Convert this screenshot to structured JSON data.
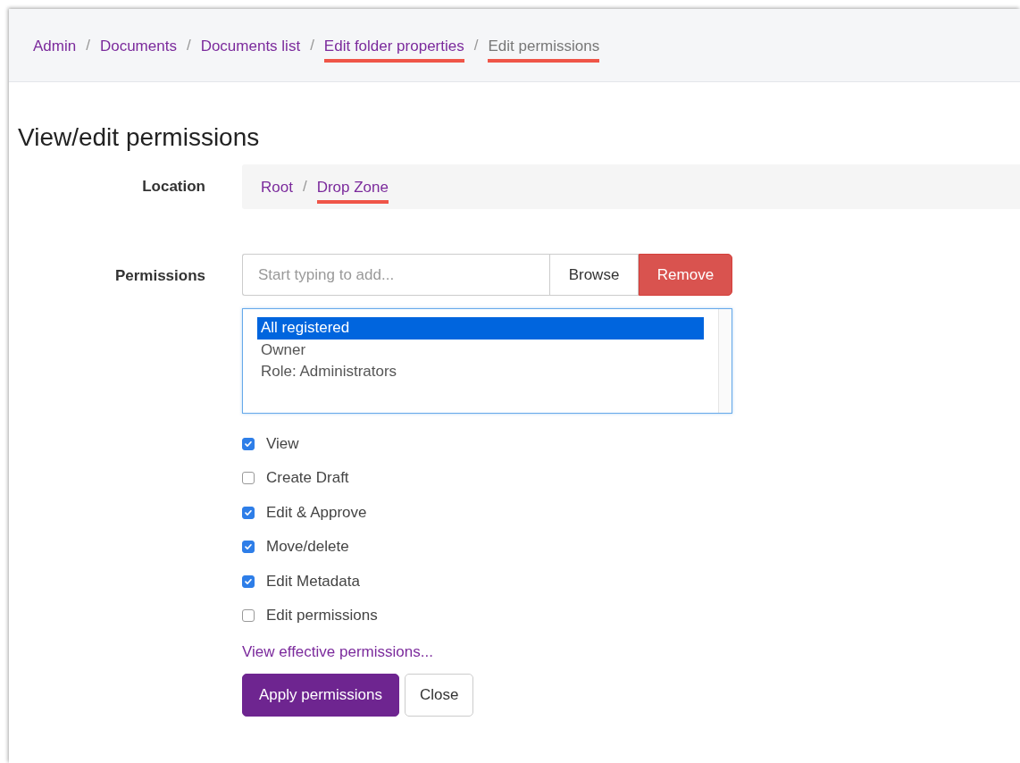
{
  "breadcrumb_separator": "/",
  "breadcrumb": [
    {
      "label": "Admin",
      "current": false,
      "underlined": false
    },
    {
      "label": "Documents",
      "current": false,
      "underlined": false
    },
    {
      "label": "Documents list",
      "current": false,
      "underlined": false
    },
    {
      "label": "Edit folder properties",
      "current": false,
      "underlined": true
    },
    {
      "label": "Edit permissions",
      "current": true,
      "underlined": true
    }
  ],
  "title": "View/edit permissions",
  "location": {
    "label": "Location",
    "separator": "/",
    "path": [
      {
        "label": "Root",
        "underlined": false
      },
      {
        "label": "Drop Zone",
        "underlined": true
      }
    ]
  },
  "permissions": {
    "label": "Permissions",
    "search": {
      "placeholder": "Start typing to add..."
    },
    "browse_button": "Browse",
    "remove_button": "Remove",
    "principals": [
      {
        "label": "All registered",
        "selected": true
      },
      {
        "label": "Owner",
        "selected": false
      },
      {
        "label": "Role: Administrators",
        "selected": false
      }
    ],
    "options": [
      {
        "label": "View",
        "checked": true
      },
      {
        "label": "Create Draft",
        "checked": false
      },
      {
        "label": "Edit & Approve",
        "checked": true
      },
      {
        "label": "Move/delete",
        "checked": true
      },
      {
        "label": "Edit Metadata",
        "checked": true
      },
      {
        "label": "Edit permissions",
        "checked": false
      }
    ],
    "link": "View effective permissions...",
    "buttons": [
      {
        "label": "Apply permissions",
        "kind": "primary"
      },
      {
        "label": "Close",
        "kind": "secondary"
      }
    ]
  }
}
